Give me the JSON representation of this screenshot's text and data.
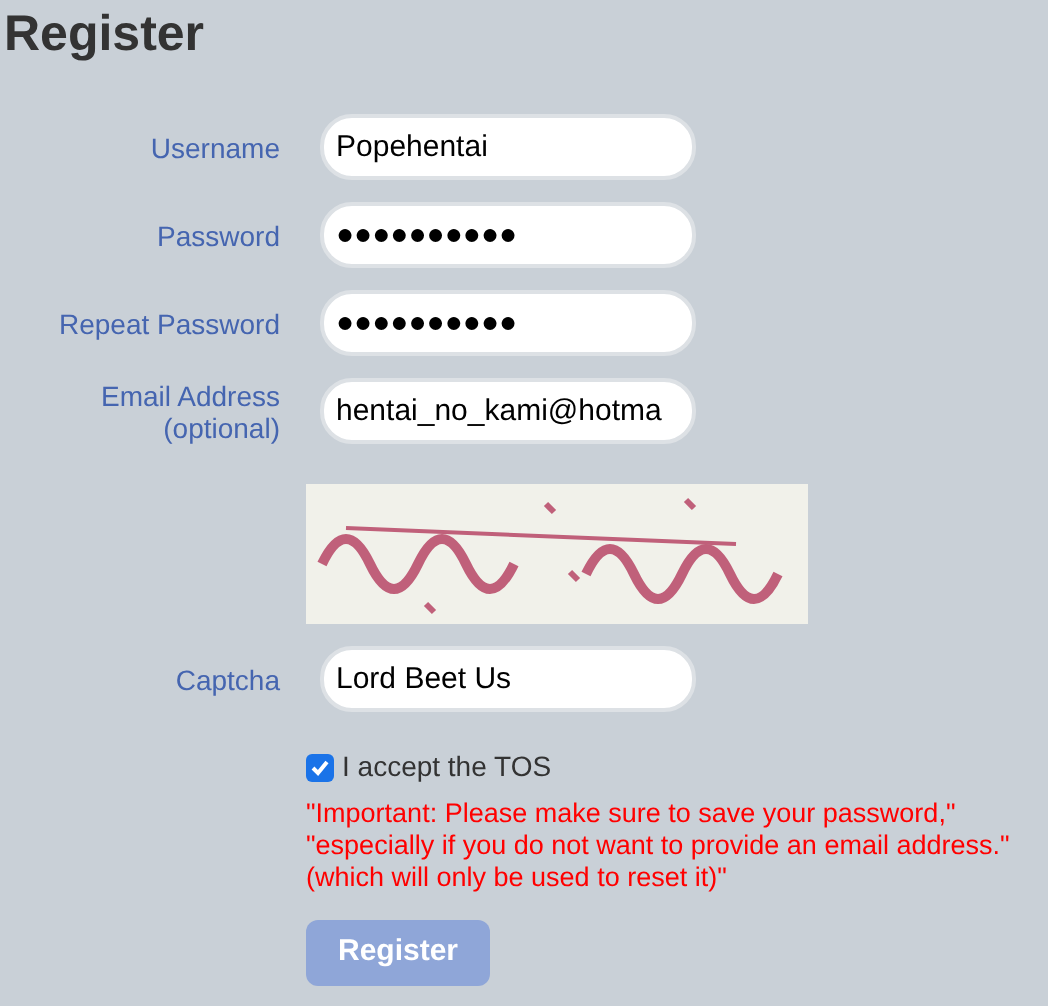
{
  "title": "Register",
  "fields": [
    {
      "label": [
        "Username"
      ],
      "value": "Popehentai"
    },
    {
      "label": [
        "Password"
      ],
      "value": "●●●●●●●●●●"
    },
    {
      "label": [
        "Repeat Password"
      ],
      "value": "●●●●●●●●●●"
    },
    {
      "label": [
        "Email Address",
        "(optional)"
      ],
      "value": "hentai_no_kami@hotma"
    }
  ],
  "captcha": {
    "label": "Captcha",
    "value": "Lord Beet Us"
  },
  "tos": {
    "label": "I accept the TOS",
    "checked": true
  },
  "notice": [
    "\"Important: Please make sure to save your password,\"",
    "\"especially if you do not want to provide an email address.\"",
    "(which will only be used to reset it)\""
  ],
  "submit": {
    "label": "Register",
    "disabled": true
  }
}
